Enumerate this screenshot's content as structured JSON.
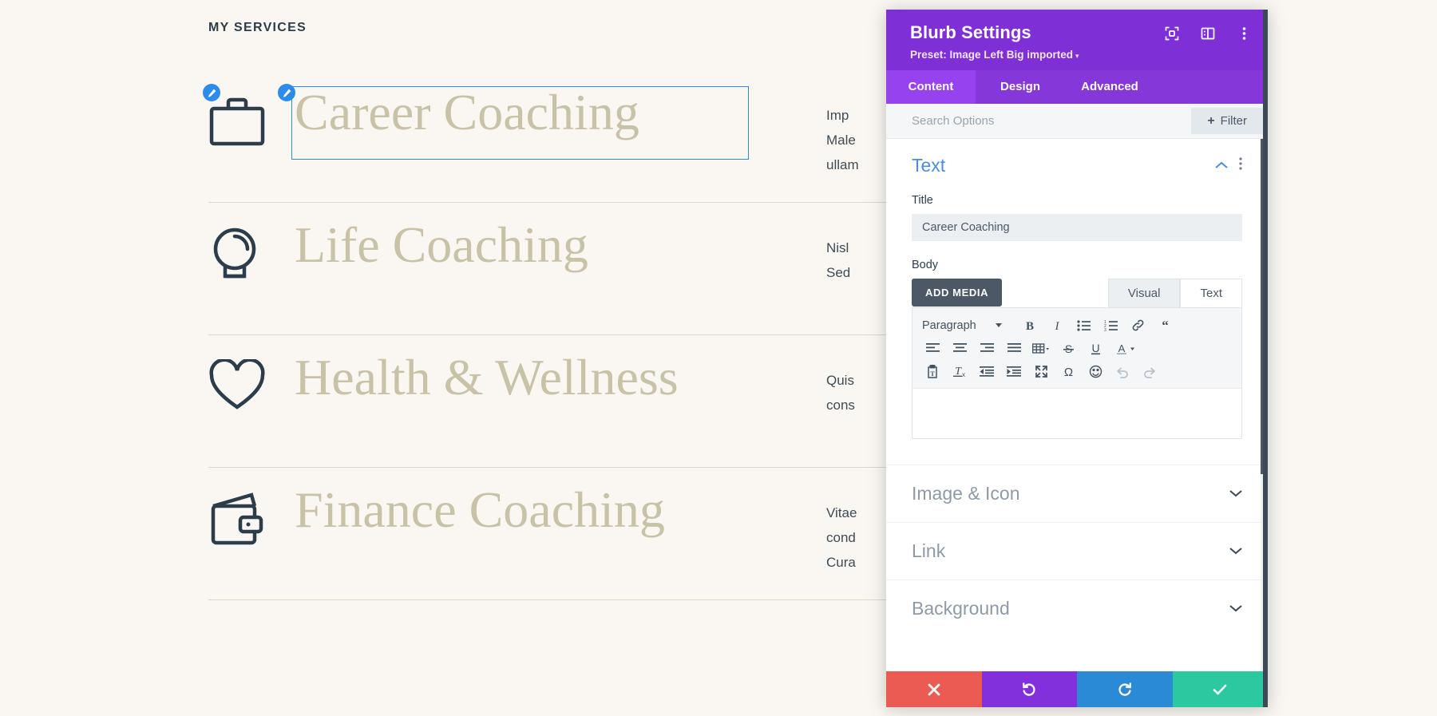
{
  "page": {
    "heading": "MY SERVICES",
    "services": [
      {
        "icon": "briefcase-icon",
        "title": "Career Coaching",
        "body_lines": [
          "Imp",
          "Male",
          "ullam"
        ],
        "selected": true
      },
      {
        "icon": "lightbulb-icon",
        "title": "Life Coaching",
        "body_lines": [
          "Nisl",
          "Sed"
        ],
        "selected": false
      },
      {
        "icon": "heart-icon",
        "title": "Health & Wellness",
        "body_lines": [
          "Quis",
          "cons"
        ],
        "selected": false
      },
      {
        "icon": "wallet-icon",
        "title": "Finance Coaching",
        "body_lines": [
          "Vitae",
          "cond",
          "Cura"
        ],
        "selected": false
      }
    ],
    "colors": {
      "background": "#faf7f2",
      "heading": "#2b3d4a",
      "title": "#c8c2a7",
      "icon": "#2b3d4a",
      "divider": "#ddd8cc",
      "selection": "#2d8ceb"
    }
  },
  "modal": {
    "title": "Blurb Settings",
    "preset_label": "Preset: Image Left Big imported",
    "preset_caret": "▾",
    "header_icons": [
      {
        "name": "focus-frame-icon"
      },
      {
        "name": "layout-panel-icon"
      },
      {
        "name": "more-vertical-icon"
      }
    ],
    "tabs": [
      {
        "label": "Content",
        "active": true
      },
      {
        "label": "Design",
        "active": false
      },
      {
        "label": "Advanced",
        "active": false
      }
    ],
    "search": {
      "placeholder": "Search Options",
      "value": "",
      "filter_label": "Filter",
      "filter_plus": "+"
    },
    "sections": {
      "text": {
        "title": "Text",
        "title_field": {
          "label": "Title",
          "value": "Career Coaching"
        },
        "body_field": {
          "label": "Body",
          "add_media_label": "ADD MEDIA",
          "editor_tabs": [
            {
              "label": "Visual",
              "active": false
            },
            {
              "label": "Text",
              "active": true
            }
          ],
          "content": "",
          "toolbar": {
            "format_select": "Paragraph",
            "row1": [
              "bold-icon",
              "italic-icon",
              "bullet-list-icon",
              "numbered-list-icon",
              "link-icon",
              "blockquote-icon"
            ],
            "row2": [
              "align-left-icon",
              "align-center-icon",
              "align-right-icon",
              "align-justify-icon",
              "table-icon",
              "strikethrough-icon",
              "underline-icon",
              "text-color-icon"
            ],
            "row3": [
              "paste-as-text-icon",
              "clear-formatting-icon",
              "outdent-icon",
              "indent-icon",
              "fullscreen-icon",
              "special-character-icon",
              "emoji-icon",
              "undo-icon",
              "redo-icon"
            ]
          }
        }
      },
      "collapsed": [
        {
          "title": "Image & Icon"
        },
        {
          "title": "Link"
        },
        {
          "title": "Background"
        }
      ]
    },
    "footer": [
      {
        "name": "cancel-button",
        "glyph": "✖",
        "color": "#eb5b54"
      },
      {
        "name": "undo-button",
        "glyph": "↺",
        "color": "#8230dc"
      },
      {
        "name": "redo-button",
        "glyph": "↻",
        "color": "#2b8ad6"
      },
      {
        "name": "save-button",
        "glyph": "✔",
        "color": "#2cc9a1"
      }
    ],
    "accent_color": "#7e2fd6"
  }
}
